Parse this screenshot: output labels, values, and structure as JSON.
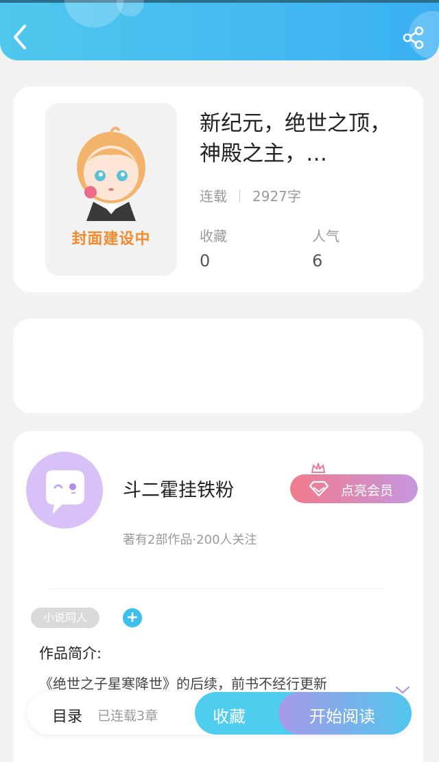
{
  "header": {
    "back_icon": "back-icon",
    "share_icon": "share-icon",
    "accent_color": "#3ab0f2"
  },
  "book": {
    "cover_text": "封面建设中",
    "title": "新纪元，绝世之顶，神殿之主，…",
    "status": "连载",
    "word_count": "2927字",
    "stats": [
      {
        "label": "收藏",
        "value": "0"
      },
      {
        "label": "人气",
        "value": "6"
      }
    ]
  },
  "author": {
    "name": "斗二霍挂铁粉",
    "meta": "著有2部作品·200人关注",
    "vip_button": "点亮会员",
    "tag": "小说同人",
    "intro_label": "作品简介:",
    "intro_text": "《绝世之子星寒降世》的后续，前书不经行更新"
  },
  "bottom_bar": {
    "toc_label": "目录",
    "toc_count": "已连载3章",
    "favorite_button": "收藏",
    "read_button": "开始阅读"
  }
}
